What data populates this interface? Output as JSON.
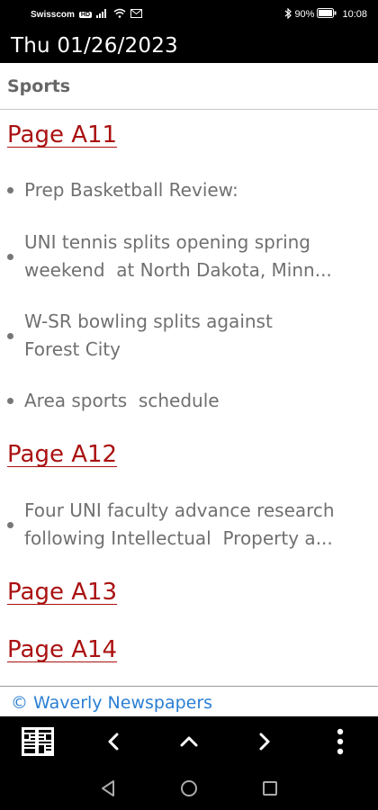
{
  "status_bar": {
    "carrier": "Swisscom",
    "network_badge": "HD",
    "battery_percent": "90%",
    "time": "10:08",
    "icons": [
      "signal-icon",
      "wifi-icon",
      "message-icon",
      "bluetooth-icon",
      "battery-icon"
    ]
  },
  "header": {
    "title": "Thu 01/26/2023"
  },
  "section": {
    "title": "Sports"
  },
  "pages": [
    {
      "label": "Page A11",
      "articles": [
        {
          "lines": [
            "Prep Basketball Review:"
          ]
        },
        {
          "lines": [
            "UNI tennis splits opening spring",
            "weekend  at North Dakota, Minn..."
          ]
        },
        {
          "lines": [
            "W-SR bowling splits against",
            "Forest City"
          ]
        },
        {
          "lines": [
            "Area sports  schedule"
          ]
        }
      ]
    },
    {
      "label": "Page A12",
      "articles": [
        {
          "lines": [
            "Four UNI faculty advance research",
            "following Intellectual  Property a..."
          ]
        }
      ]
    },
    {
      "label": "Page A13",
      "articles": []
    },
    {
      "label": "Page A14",
      "articles": []
    }
  ],
  "footer": {
    "copyright": "© Waverly Newspapers"
  },
  "toolbar": {
    "icons": [
      "newspaper-grid-icon",
      "chevron-left-icon",
      "chevron-up-icon",
      "chevron-right-icon",
      "more-vertical-icon"
    ]
  },
  "system_nav": {
    "icons": [
      "back-triangle-icon",
      "home-circle-icon",
      "recents-square-icon"
    ]
  },
  "colors": {
    "link": "#aa1111",
    "footer_link": "#2a7fd4",
    "text": "#707070",
    "bars": "#000000"
  }
}
